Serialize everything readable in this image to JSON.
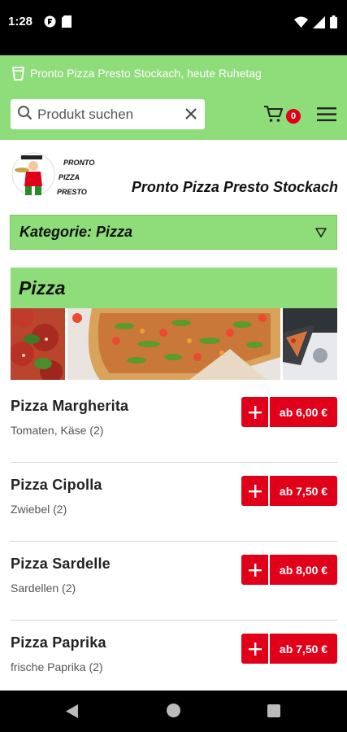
{
  "status_bar": {
    "time": "1:28",
    "icons_left": [
      "fdroid-icon",
      "sd-card-icon"
    ],
    "icons_right": [
      "wifi-icon",
      "signal-icon",
      "battery-icon"
    ]
  },
  "notice": {
    "icon": "cup-icon",
    "text": "Pronto Pizza Presto Stockach, heute Ruhetag"
  },
  "search": {
    "placeholder": "Produkt suchen",
    "value": "",
    "clear_icon": "close-icon"
  },
  "cart": {
    "icon": "cart-icon",
    "count": "0"
  },
  "menu": {
    "icon": "hamburger-icon"
  },
  "brand": {
    "logo_text": [
      "PRONTO",
      "PIZZA",
      "PRESTO"
    ],
    "shop_name": "Pronto Pizza Presto Stockach"
  },
  "category": {
    "label": "Kategorie: Pizza",
    "icon": "triangle-down-icon"
  },
  "section": {
    "title": "Pizza"
  },
  "products": [
    {
      "name": "Pizza Margherita",
      "description": "Tomaten, Käse (2)",
      "price": "ab 6,00 €"
    },
    {
      "name": "Pizza Cipolla",
      "description": "Zwiebel (2)",
      "price": "ab 7,50 €"
    },
    {
      "name": "Pizza Sardelle",
      "description": "Sardellen (2)",
      "price": "ab 8,00 €"
    },
    {
      "name": "Pizza Paprika",
      "description": "frische Paprika (2)",
      "price": "ab 7,50 €"
    }
  ],
  "colors": {
    "brand_green": "#8fdc7a",
    "accent_red": "#e1001a"
  }
}
